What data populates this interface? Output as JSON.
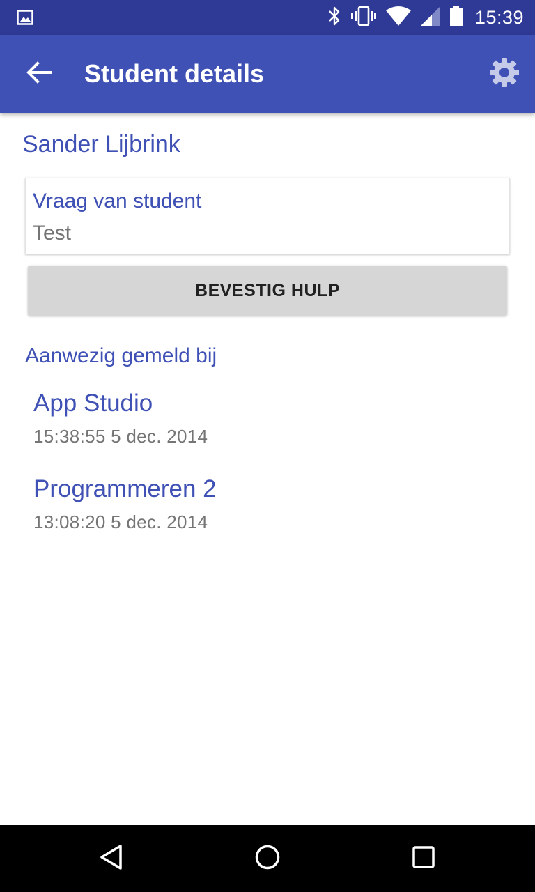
{
  "status_bar": {
    "time": "15:39",
    "icons": [
      "image-notification-icon",
      "bluetooth-icon",
      "vibrate-icon",
      "wifi-icon",
      "cell-signal-icon",
      "battery-icon"
    ]
  },
  "app_bar": {
    "title": "Student details",
    "back_icon": "arrow-back-icon",
    "settings_icon": "gear-icon",
    "color": "#3f51b5",
    "status_color": "#2f3a96"
  },
  "student": {
    "name": "Sander Lijbrink"
  },
  "question": {
    "label": "Vraag van student",
    "text": "Test"
  },
  "confirm_button": {
    "label": "BEVESTIG HULP"
  },
  "attendance": {
    "title": "Aanwezig gemeld bij",
    "items": [
      {
        "course": "App Studio",
        "time": "15:38:55 5 dec. 2014"
      },
      {
        "course": "Programmeren 2",
        "time": "13:08:20 5 dec. 2014"
      }
    ]
  },
  "nav_bar": {
    "icons": [
      "nav-back-icon",
      "nav-home-icon",
      "nav-recents-icon"
    ]
  }
}
